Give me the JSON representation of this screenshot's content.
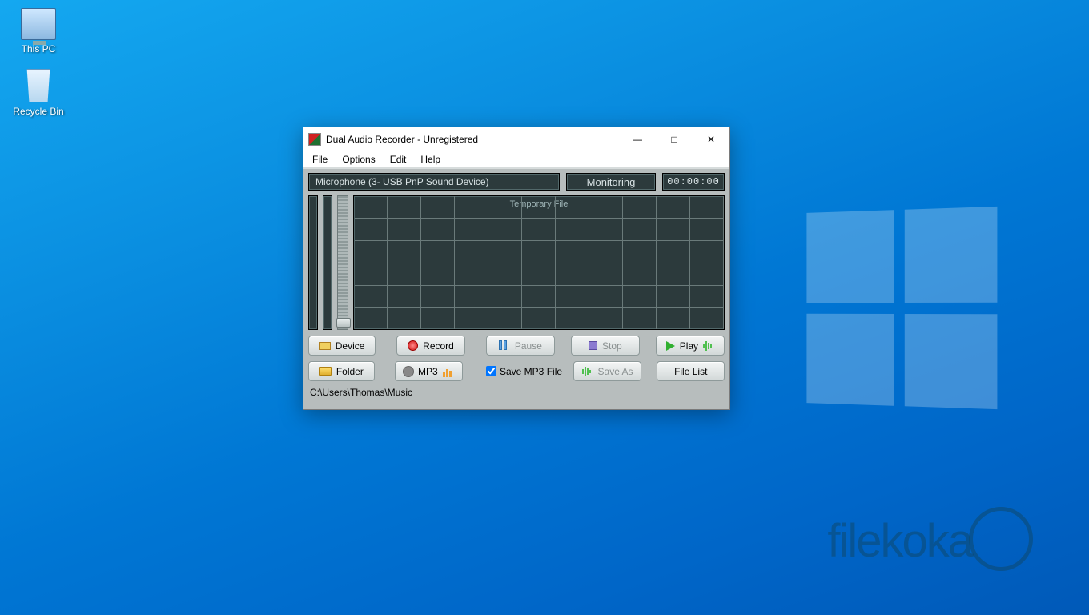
{
  "desktop": {
    "icons": [
      {
        "id": "this-pc",
        "label": "This PC"
      },
      {
        "id": "recycle-bin",
        "label": "Recycle Bin"
      }
    ],
    "watermark": "filekoka"
  },
  "window": {
    "title": "Dual Audio Recorder - Unregistered",
    "menu": [
      "File",
      "Options",
      "Edit",
      "Help"
    ],
    "status": {
      "device": "Microphone (3- USB PnP Sound Device)",
      "mode": "Monitoring",
      "timer": "00:00:00"
    },
    "waveform_label": "Temporary File",
    "buttons_row1": [
      {
        "id": "device",
        "label": "Device",
        "icon": "device",
        "enabled": true
      },
      {
        "id": "record",
        "label": "Record",
        "icon": "rec",
        "enabled": true
      },
      {
        "id": "pause",
        "label": "Pause",
        "icon": "pause",
        "enabled": false
      },
      {
        "id": "stop",
        "label": "Stop",
        "icon": "stop",
        "enabled": false
      },
      {
        "id": "play",
        "label": "Play",
        "icon": "play",
        "enabled": true
      }
    ],
    "buttons_row2": [
      {
        "id": "folder",
        "label": "Folder",
        "icon": "folder",
        "enabled": true
      },
      {
        "id": "mp3",
        "label": "MP3",
        "icon": "gear",
        "enabled": true
      },
      {
        "id": "save-as",
        "label": "Save As",
        "icon": "wave",
        "enabled": false
      },
      {
        "id": "filelist",
        "label": "File List",
        "icon": "",
        "enabled": true
      }
    ],
    "save_mp3_checkbox": {
      "label": "Save MP3 File",
      "checked": true
    },
    "path": "C:\\Users\\Thomas\\Music"
  }
}
